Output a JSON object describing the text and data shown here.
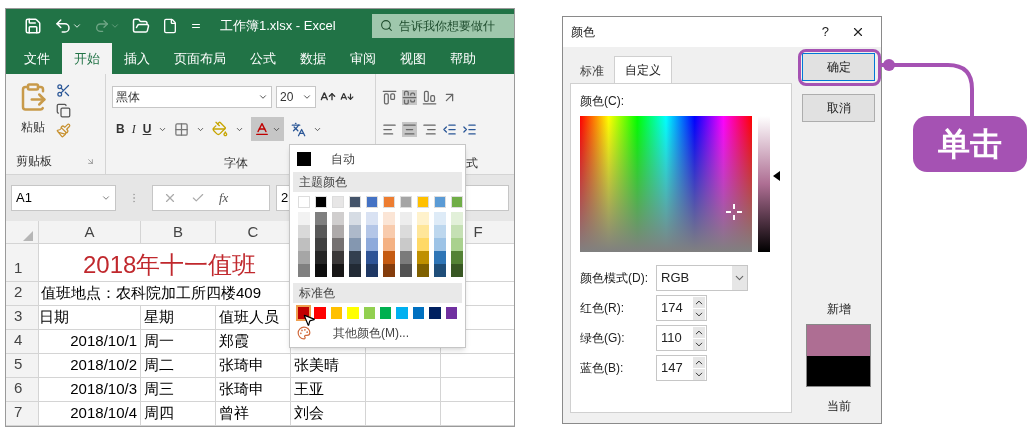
{
  "excel": {
    "title": "工作簿1.xlsx - Excel",
    "search": {
      "placeholder": "告诉我你想要做什"
    },
    "tabs": [
      {
        "label": "文件",
        "selected": false
      },
      {
        "label": "开始",
        "selected": true
      },
      {
        "label": "插入",
        "selected": false
      },
      {
        "label": "页面布局",
        "selected": false
      },
      {
        "label": "公式",
        "selected": false
      },
      {
        "label": "数据",
        "selected": false
      },
      {
        "label": "审阅",
        "selected": false
      },
      {
        "label": "视图",
        "selected": false
      },
      {
        "label": "帮助",
        "selected": false
      }
    ],
    "ribbon": {
      "paste_label": "粘贴",
      "font_name": "黑体",
      "font_size": "20",
      "bold": "B",
      "italic": "I",
      "underline": "U",
      "group_labels": [
        "剪贴板",
        "字体",
        "式"
      ]
    },
    "name_box": "A1",
    "fx": "fx",
    "formula": "2",
    "columns": [
      "A",
      "B",
      "C",
      "F"
    ],
    "rows": [
      {
        "num": "1",
        "kind": "title",
        "text": "2018年十一值班"
      },
      {
        "num": "2",
        "kind": "note",
        "text": "值班地点：农科院加工所四楼409"
      },
      {
        "num": "3",
        "kind": "data",
        "cells": [
          "日期",
          "星期",
          "值班人员"
        ]
      },
      {
        "num": "4",
        "kind": "data",
        "cells": [
          "2018/10/1",
          "周一",
          "郑霞"
        ]
      },
      {
        "num": "5",
        "kind": "data",
        "cells": [
          "2018/10/2",
          "周二",
          "张琦申",
          "张美晴"
        ]
      },
      {
        "num": "6",
        "kind": "data",
        "cells": [
          "2018/10/3",
          "周三",
          "张琦申",
          "王亚"
        ]
      },
      {
        "num": "7",
        "kind": "data",
        "cells": [
          "2018/10/4",
          "周四",
          "曾祥",
          "刘会"
        ]
      }
    ],
    "color_menu": {
      "auto": {
        "label": "自动",
        "color": "#000000"
      },
      "theme_label": "主题颜色",
      "theme_colors": [
        {
          "color": "#ffffff",
          "shades": [
            {
              "color": "#f2f2f2"
            },
            {
              "color": "#d9d9d9"
            },
            {
              "color": "#bfbfbf"
            },
            {
              "color": "#a6a6a6"
            },
            {
              "color": "#808080"
            }
          ]
        },
        {
          "color": "#000000",
          "shades": [
            {
              "color": "#7f7f7f"
            },
            {
              "color": "#595959"
            },
            {
              "color": "#404040"
            },
            {
              "color": "#262626"
            },
            {
              "color": "#0d0d0d"
            }
          ]
        },
        {
          "color": "#e7e6e6",
          "shades": [
            {
              "color": "#d0cece"
            },
            {
              "color": "#aeaaaa"
            },
            {
              "color": "#757171"
            },
            {
              "color": "#3b3838"
            },
            {
              "color": "#171616"
            }
          ]
        },
        {
          "color": "#44546a",
          "shades": [
            {
              "color": "#d6dce4"
            },
            {
              "color": "#adb9ca"
            },
            {
              "color": "#8497b0"
            },
            {
              "color": "#333f4f"
            },
            {
              "color": "#222a35"
            }
          ]
        },
        {
          "color": "#4472c4",
          "shades": [
            {
              "color": "#d9e2f3"
            },
            {
              "color": "#b4c6e7"
            },
            {
              "color": "#8eaadb"
            },
            {
              "color": "#2f5496"
            },
            {
              "color": "#1f3864"
            }
          ]
        },
        {
          "color": "#ed7d31",
          "shades": [
            {
              "color": "#fbe5d6"
            },
            {
              "color": "#f8cbad"
            },
            {
              "color": "#f4b183"
            },
            {
              "color": "#c55a11"
            },
            {
              "color": "#843c0c"
            }
          ]
        },
        {
          "color": "#a5a5a5",
          "shades": [
            {
              "color": "#ededed"
            },
            {
              "color": "#dbdbdb"
            },
            {
              "color": "#c9c9c9"
            },
            {
              "color": "#7b7b7b"
            },
            {
              "color": "#525252"
            }
          ]
        },
        {
          "color": "#ffc000",
          "shades": [
            {
              "color": "#fff2cc"
            },
            {
              "color": "#ffe699"
            },
            {
              "color": "#ffd966"
            },
            {
              "color": "#bf9000"
            },
            {
              "color": "#7f6000"
            }
          ]
        },
        {
          "color": "#5b9bd5",
          "shades": [
            {
              "color": "#deebf7"
            },
            {
              "color": "#bdd7ee"
            },
            {
              "color": "#9dc3e6"
            },
            {
              "color": "#2e75b6"
            },
            {
              "color": "#1f4e79"
            }
          ]
        },
        {
          "color": "#70ad47",
          "shades": [
            {
              "color": "#e2f0d9"
            },
            {
              "color": "#c5e0b4"
            },
            {
              "color": "#a9d18e"
            },
            {
              "color": "#548235"
            },
            {
              "color": "#385723"
            }
          ]
        }
      ],
      "standard_label": "标准色",
      "standard_colors": [
        {
          "color": "#c00000",
          "selected": true
        },
        {
          "color": "#ff0000",
          "selected": false
        },
        {
          "color": "#ffc000",
          "selected": false
        },
        {
          "color": "#ffff00",
          "selected": false
        },
        {
          "color": "#92d050",
          "selected": false
        },
        {
          "color": "#00b050",
          "selected": false
        },
        {
          "color": "#00b0f0",
          "selected": false
        },
        {
          "color": "#0070c0",
          "selected": false
        },
        {
          "color": "#002060",
          "selected": false
        },
        {
          "color": "#7030a0",
          "selected": false
        }
      ],
      "more_label": "其他颜色(M)..."
    }
  },
  "dialog": {
    "title": "颜色",
    "help": "?",
    "tabs": [
      {
        "label": "标准",
        "selected": false
      },
      {
        "label": "自定义",
        "selected": true
      }
    ],
    "colors_label": "颜色(C):",
    "luminance": {
      "level": 0.56
    },
    "model_label": "颜色模式(D):",
    "model": "RGB",
    "channels": [
      {
        "label": "红色(R):",
        "value": "174"
      },
      {
        "label": "绿色(G):",
        "value": "110"
      },
      {
        "label": "蓝色(B):",
        "value": "147"
      }
    ],
    "buttons": [
      {
        "label": "确定",
        "highlighted": true
      },
      {
        "label": "取消",
        "highlighted": false
      }
    ],
    "new": {
      "label": "新增",
      "color": "#ae6e93"
    },
    "current": {
      "label": "当前",
      "color": "#000000"
    }
  },
  "callout": {
    "text": "单击"
  }
}
